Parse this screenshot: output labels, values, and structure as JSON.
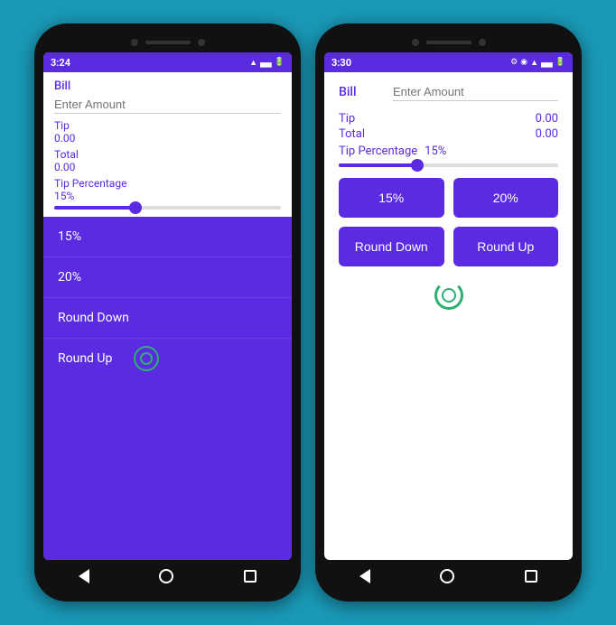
{
  "left_phone": {
    "status_bar": {
      "time": "3:24",
      "icons": [
        "location",
        "shield",
        "battery"
      ]
    },
    "bill_label": "Bill",
    "bill_placeholder": "Enter Amount",
    "tip_label": "Tip",
    "tip_value": "0.00",
    "total_label": "Total",
    "total_value": "0.00",
    "tip_percentage_label": "Tip Percentage",
    "tip_percentage_value": "15%",
    "dropdown_items": [
      "15%",
      "20%",
      "Round Down",
      "Round Up"
    ],
    "nav": {
      "back": "◀",
      "home": "●",
      "recents": "■"
    }
  },
  "right_phone": {
    "status_bar": {
      "time": "3:30",
      "icons": [
        "gear",
        "location",
        "shield",
        "battery"
      ]
    },
    "bill_label": "Bill",
    "bill_placeholder": "Enter Amount",
    "tip_label": "Tip",
    "tip_value": "0.00",
    "total_label": "Total",
    "total_value": "0.00",
    "tip_percentage_label": "Tip Percentage",
    "tip_percentage_value": "15%",
    "buttons": [
      "15%",
      "20%",
      "Round Down",
      "Round Up"
    ],
    "nav": {
      "back": "◀",
      "home": "●",
      "recents": "■"
    }
  },
  "colors": {
    "purple": "#5a2be0",
    "green": "#2db070",
    "white": "#ffffff",
    "gray": "#999999"
  }
}
